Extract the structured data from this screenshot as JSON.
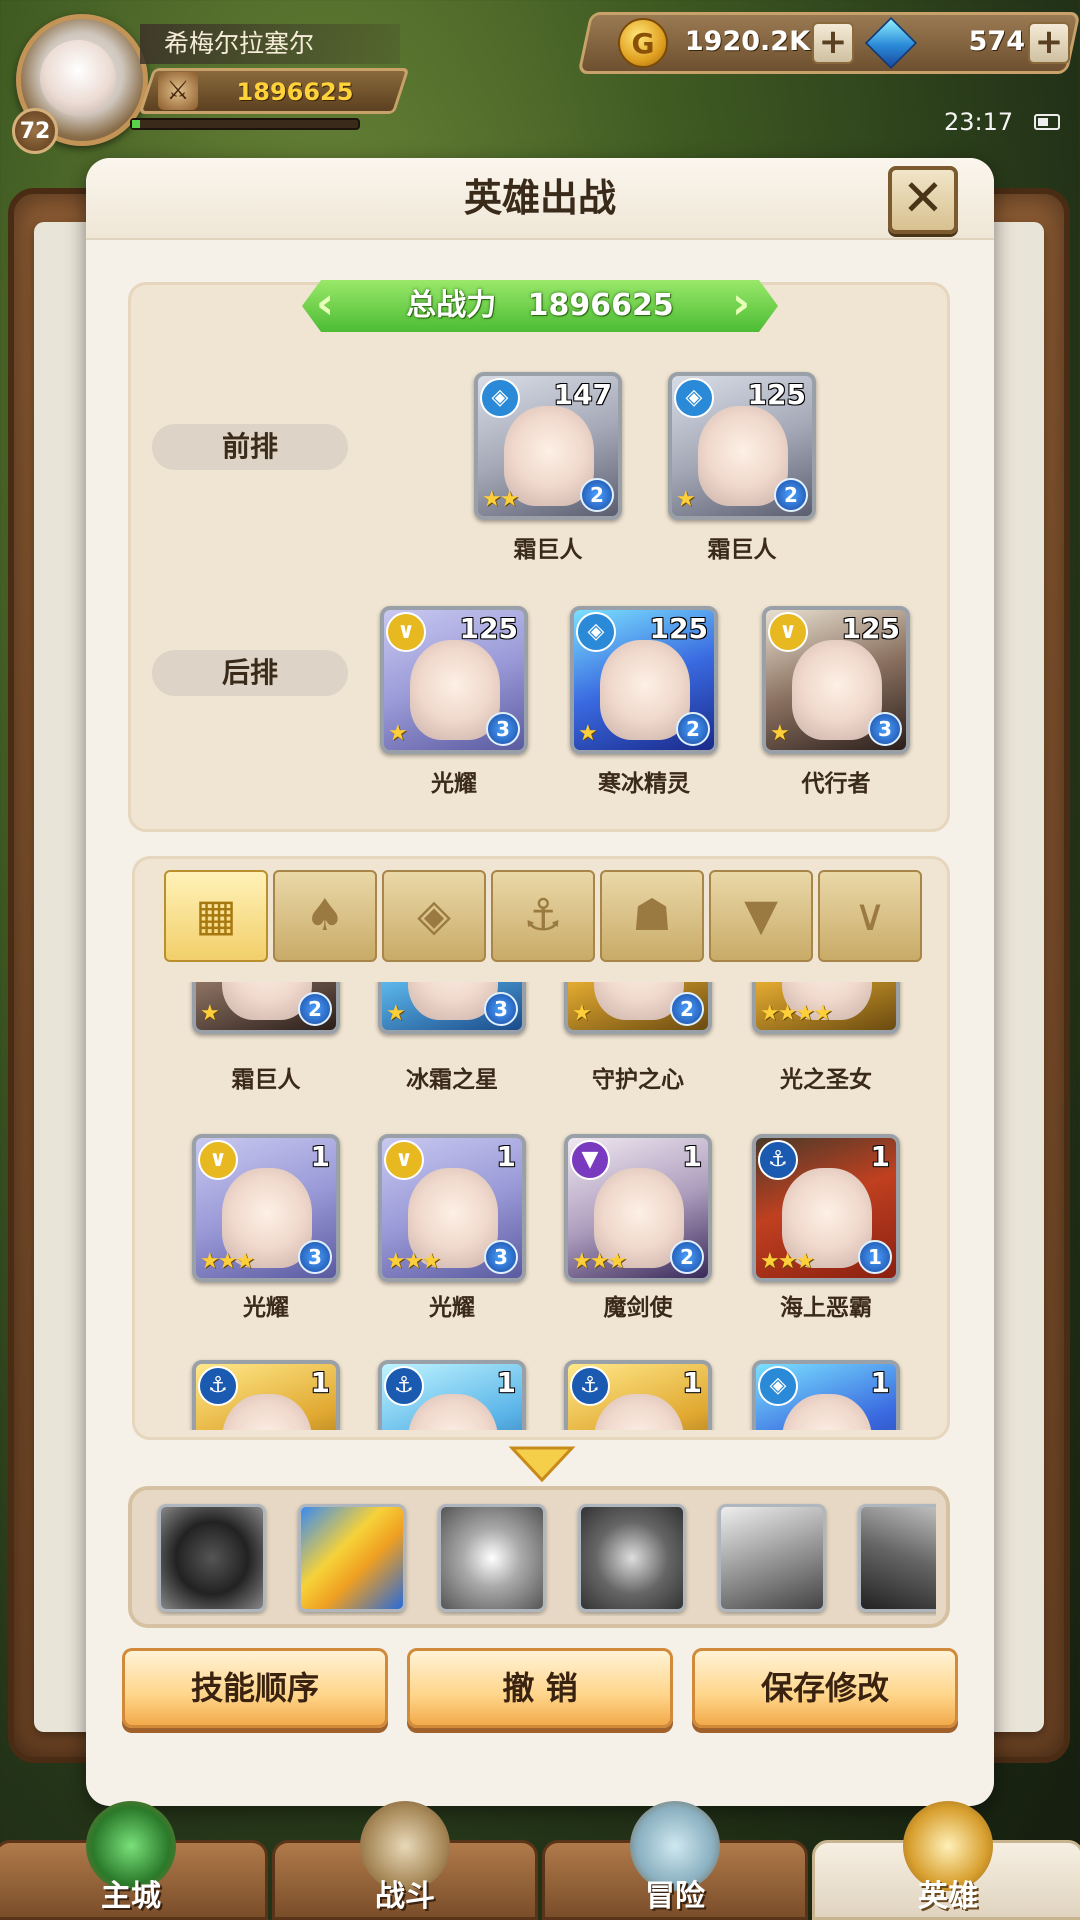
{
  "player": {
    "name": "希梅尔拉塞尔",
    "level": "72",
    "power": "1896625"
  },
  "currency": {
    "gold": "1920.2K",
    "gems": "574"
  },
  "status": {
    "time": "23:17"
  },
  "dialog": {
    "title": "英雄出战",
    "total_power_label": "总战力",
    "total_power_value": "1896625",
    "front_row_label": "前排",
    "back_row_label": "后排"
  },
  "front_row": [
    {
      "name": "霜巨人",
      "level": "147",
      "rank": "2",
      "class_icon": "frost-class-icon",
      "stars": "★★"
    },
    {
      "name": "霜巨人",
      "level": "125",
      "rank": "2",
      "class_icon": "frost-class-icon",
      "stars": "★"
    }
  ],
  "back_row": [
    {
      "name": "光耀",
      "level": "125",
      "rank": "3",
      "class_icon": "light-class-icon",
      "stars": "★"
    },
    {
      "name": "寒冰精灵",
      "level": "125",
      "rank": "2",
      "class_icon": "frost-class-icon",
      "stars": "★"
    },
    {
      "name": "代行者",
      "level": "125",
      "rank": "3",
      "class_icon": "light-class-icon",
      "stars": "★"
    }
  ],
  "filter_tabs": [
    {
      "icon": "grid-icon",
      "glyph": "▦",
      "active": true
    },
    {
      "icon": "leaf-class-icon",
      "glyph": "♠"
    },
    {
      "icon": "frost-class-icon",
      "glyph": "◈"
    },
    {
      "icon": "anchor-class-icon",
      "glyph": "⚓"
    },
    {
      "icon": "beast-class-icon",
      "glyph": "☗"
    },
    {
      "icon": "demon-class-icon",
      "glyph": "▼"
    },
    {
      "icon": "light-class-icon",
      "glyph": "∨"
    }
  ],
  "roster": [
    {
      "name": "霜巨人",
      "level": "",
      "rank": "2",
      "stars": "★"
    },
    {
      "name": "冰霜之星",
      "level": "",
      "rank": "3",
      "stars": "★"
    },
    {
      "name": "守护之心",
      "level": "",
      "rank": "2",
      "stars": "★"
    },
    {
      "name": "光之圣女",
      "level": "",
      "rank": "",
      "stars": "★★★★"
    },
    {
      "name": "光耀",
      "level": "1",
      "rank": "3",
      "stars": "★★★"
    },
    {
      "name": "光耀",
      "level": "1",
      "rank": "3",
      "stars": "★★★"
    },
    {
      "name": "魔剑使",
      "level": "1",
      "rank": "2",
      "stars": "★★★"
    },
    {
      "name": "海上恶霸",
      "level": "1",
      "rank": "1",
      "stars": "★★★"
    },
    {
      "name": "",
      "level": "1",
      "rank": "",
      "stars": ""
    },
    {
      "name": "",
      "level": "1",
      "rank": "",
      "stars": ""
    },
    {
      "name": "",
      "level": "1",
      "rank": "",
      "stars": ""
    },
    {
      "name": "",
      "level": "1",
      "rank": "",
      "stars": ""
    }
  ],
  "actions": {
    "skill_order": "技能顺序",
    "undo": "撤 销",
    "save": "保存修改"
  },
  "nav": [
    {
      "label": "主城",
      "active": false
    },
    {
      "label": "战斗",
      "active": false
    },
    {
      "label": "冒险",
      "active": false
    },
    {
      "label": "英雄",
      "active": true
    }
  ]
}
